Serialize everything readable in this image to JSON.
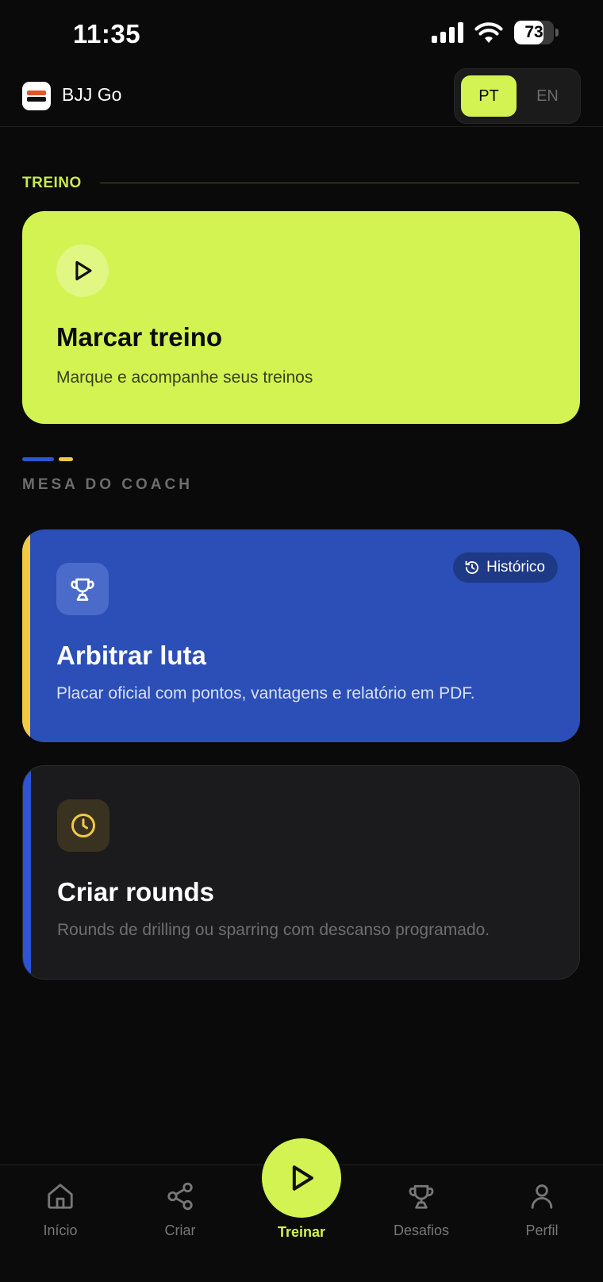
{
  "status_bar": {
    "time": "11:35",
    "battery_level": "73",
    "icons": [
      "signal-icon",
      "wifi-icon",
      "battery-icon"
    ]
  },
  "header": {
    "app_name": "BJJ Go",
    "language": {
      "options": [
        "PT",
        "EN"
      ],
      "selected": "PT"
    }
  },
  "sections": {
    "training": "TREINO",
    "coach": "MESA DO COACH"
  },
  "cards": {
    "training": {
      "icon": "play-icon",
      "title": "Marcar treino",
      "subtitle": "Marque e acompanhe seus treinos"
    },
    "referee": {
      "icon": "trophy-icon",
      "title": "Arbitrar luta",
      "subtitle": "Placar oficial com pontos, vantagens e relatório em PDF.",
      "badge": "Histórico",
      "badge_icon": "history-icon"
    },
    "rounds": {
      "icon": "clock-icon",
      "title": "Criar rounds",
      "subtitle": "Rounds de drilling ou sparring com descanso programado."
    }
  },
  "bottom_nav": {
    "home": "Início",
    "create": "Criar",
    "train": "Treinar",
    "challenges": "Desafios",
    "profile": "Perfil",
    "active": "Treinar"
  },
  "colors": {
    "accent_lime": "#d2f352",
    "accent_blue": "#2b4fb6",
    "accent_yellow": "#f0c947",
    "background": "#0a0a0a"
  }
}
